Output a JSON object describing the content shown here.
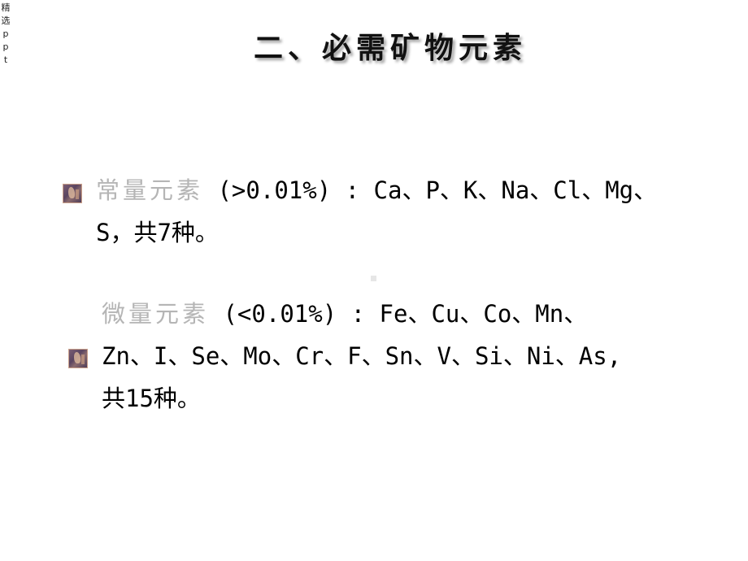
{
  "side_label": {
    "chars": [
      "精",
      "选",
      "p",
      "p",
      "t"
    ]
  },
  "slide": {
    "title": "二、必需矿物元素",
    "sections": [
      {
        "term": "常量元素",
        "lines": [
          " (>0.01%) : Ca、P、K、Na、Cl、Mg、",
          "S，共7种。"
        ],
        "bullet_icon": "image-bullet-icon"
      },
      {
        "term": "微量元素",
        "lines": [
          " (<0.01%) : Fe、Cu、Co、Mn、",
          "Zn、I、Se、Mo、Cr、F、Sn、V、Si、Ni、As,",
          "共15种。"
        ],
        "bullet_icon": "image-bullet-icon"
      }
    ]
  },
  "colors": {
    "term_color": "#b5b5b5",
    "text_color": "#000000",
    "background": "#ffffff"
  }
}
